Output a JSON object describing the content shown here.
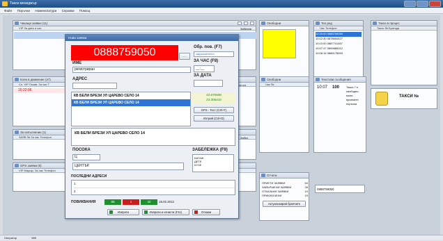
{
  "window": {
    "title": "Такси мениджър"
  },
  "menu": [
    "Файл",
    "Поръчки",
    "Номенклатури",
    "Справки",
    "Помощ"
  ],
  "panels": {
    "orders": {
      "title": "Чакащи заявки (11)",
      "cols": "VIP  За дата и час",
      "right_label": "Забележ"
    },
    "cars": {
      "title": "Коли в движение (47)",
      "cols": "Сл.  VIP  Позив.  За час  Т",
      "row_time": "15:22:06",
      "right_label": "пол.сл"
    },
    "in_progress": {
      "title": "За изпълнение (1)",
      "cols": "ЗАЯВ  №  За час  Телефон",
      "right_label": "Забел"
    },
    "gps": {
      "title": "GPS заявки (0)",
      "cols": "VIP  Маршр.  За час  Телефон"
    },
    "center": {
      "title": "Свободни"
    },
    "calls": {
      "title": "Тел.ред",
      "cols": "Час  Телефон"
    },
    "messages": {
      "title": "Текстови съобщения",
      "cols": "Час  №",
      "msg_time": "10:07",
      "msg_num": "100",
      "msg_text": "Такси 7 е свободно, моля приемете поръчка"
    },
    "drivers": {
      "title": "Такси в процес",
      "cols": "Такси №  Бригада"
    },
    "free": {
      "title": "Свободни"
    },
    "reports": {
      "title": "Отчети"
    }
  },
  "calls": [
    {
      "time": "10:20:00",
      "phone": "0888759050"
    },
    {
      "time": "10:12:30",
      "phone": "0878654427"
    },
    {
      "time": "10:10:00",
      "phone": "0887741467"
    },
    {
      "time": "10:07:47",
      "phone": "0899885312"
    },
    {
      "time": "10:06:16",
      "phone": "0886178593"
    }
  ],
  "counts": [
    {
      "label": "ПРИЕТИ ЗАЯВКИ",
      "value": "54"
    },
    {
      "label": "ЗАВЪРШЕНИ ЗАЯВКИ",
      "value": "28"
    },
    {
      "label": "ОТКАЗАНИ ЗАЯВКИ",
      "value": "19"
    },
    {
      "label": "ПРИКЛЮЧЕНИ",
      "value": "15"
    }
  ],
  "reports_button": "Актуализирай броячите",
  "phone_field": "0888759050",
  "taxi_label": "ТАКСИ №",
  "dialog": {
    "title": "Нова заявка",
    "phone": "0888759050",
    "name_label": "ИМЕ",
    "name_value": "регистриран",
    "address_label": "АДРЕС",
    "obr_label": "Обр. пов. (F7)",
    "obr_value": "задължително",
    "time_label": "ЗА ЧАС (F8)",
    "time_value": "__:__",
    "date_label": "ЗА ДАТА",
    "address_lines": [
      "КВ БЕЛИ БРЕЗИ УЛ ЦАРЕВО СЕЛО 14",
      "КВ БЕЛИ БРЕЗИ УЛ ЦАРЕВО СЕЛО 14"
    ],
    "coord1": "42.670608",
    "coord2": "23.306410",
    "gps_button": "GPS - Тест (Ctrl+T)",
    "remove_button": "Изтрий (Ctrl+D)",
    "address_full": "КВ БЕЛИ БРЕЗИ УЛ ЦАРЕВО СЕЛО 14",
    "direction_label": "ПОСОКА",
    "direction_value": "Ц",
    "direction_text": "ЦЕНТЪР.",
    "note_label": "ЗАБЕЛЕЖКА (F9)",
    "note_items": [
      "БАГАЖ",
      "ДЕТЕ",
      "КУЧЕ"
    ],
    "last_label": "ПОСЛЕДНИ АДРЕСИ",
    "last_rows": [
      "1",
      "2"
    ],
    "calls_label": "ПОВИКВАНИЯ",
    "call_green": "65",
    "call_red": "1",
    "call_green2": "42",
    "call_date": "15.02.2012",
    "btn_send": "Изпрати",
    "btn_send_all": "Изпрати и изчисти (F11)",
    "btn_cancel": "Откажи"
  },
  "status": [
    "Оператор",
    "Wifi"
  ],
  "colors": {
    "phone_bg": "#ff0000",
    "yellow": "#ffff00",
    "selection": "#2e74d6"
  }
}
